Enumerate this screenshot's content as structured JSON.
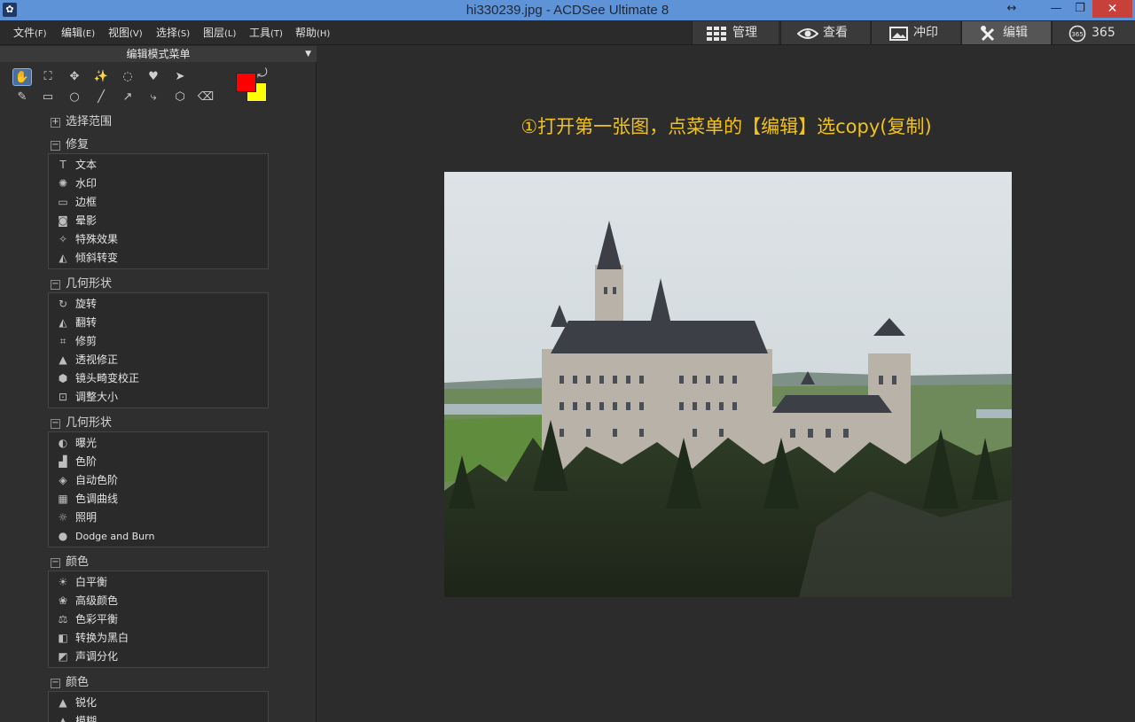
{
  "window": {
    "title": "hi330239.jpg - ACDSee Ultimate 8",
    "resize_glyph": "↔",
    "min_glyph": "—",
    "max_glyph": "❐",
    "close_glyph": "✕"
  },
  "menu": [
    {
      "label": "文件",
      "key": "(F)"
    },
    {
      "label": "编辑",
      "key": "(E)"
    },
    {
      "label": "视图",
      "key": "(V)"
    },
    {
      "label": "选择",
      "key": "(S)"
    },
    {
      "label": "图层",
      "key": "(L)"
    },
    {
      "label": "工具",
      "key": "(T)"
    },
    {
      "label": "帮助",
      "key": "(H)"
    }
  ],
  "mode_tabs": [
    {
      "label": "管理",
      "icon": "grid-icon"
    },
    {
      "label": "查看",
      "icon": "eye-icon"
    },
    {
      "label": "冲印",
      "icon": "photo-icon"
    },
    {
      "label": "编辑",
      "icon": "edit-tools-icon",
      "active": true
    },
    {
      "label": "365",
      "icon": "cloud-365-icon",
      "badge": "365"
    }
  ],
  "panel": {
    "title": "编辑模式菜单",
    "dropdown_glyph": "▼",
    "colors": {
      "foreground": "#ff0000",
      "background": "#ffff00"
    },
    "tools_row1": [
      "hand-icon",
      "transform-icon",
      "move-icon",
      "magic-wand-icon",
      "lasso-icon",
      "brush-select-icon",
      "auto-select-icon"
    ],
    "tools_row2": [
      "pen-icon",
      "rectangle-icon",
      "circle-icon",
      "line-icon",
      "arrow-icon",
      "curve-icon",
      "polygon-icon",
      "eraser-icon"
    ],
    "sections": [
      {
        "title": "选择范围",
        "expanded": false,
        "items": []
      },
      {
        "title": "修复",
        "expanded": true,
        "items": [
          {
            "label": "文本",
            "icon": "text-icon",
            "glyph": "T"
          },
          {
            "label": "水印",
            "icon": "watermark-icon",
            "glyph": "✺"
          },
          {
            "label": "边框",
            "icon": "border-icon",
            "glyph": "▭"
          },
          {
            "label": "晕影",
            "icon": "vignette-icon",
            "glyph": "◙"
          },
          {
            "label": "特殊效果",
            "icon": "special-effects-icon",
            "glyph": "✧"
          },
          {
            "label": "倾斜转变",
            "icon": "tilt-shift-icon",
            "glyph": "◭"
          }
        ]
      },
      {
        "title": "几何形状",
        "expanded": true,
        "items": [
          {
            "label": "旋转",
            "icon": "rotate-icon",
            "glyph": "↻"
          },
          {
            "label": "翻转",
            "icon": "flip-icon",
            "glyph": "◭"
          },
          {
            "label": "修剪",
            "icon": "crop-icon",
            "glyph": "⌗"
          },
          {
            "label": "透视修正",
            "icon": "perspective-icon",
            "glyph": "▲"
          },
          {
            "label": "镜头畸变校正",
            "icon": "lens-distortion-icon",
            "glyph": "⬢"
          },
          {
            "label": "调整大小",
            "icon": "resize-icon",
            "glyph": "⊡"
          }
        ]
      },
      {
        "title": "几何形状",
        "expanded": true,
        "items": [
          {
            "label": "曝光",
            "icon": "exposure-icon",
            "glyph": "◐"
          },
          {
            "label": "色阶",
            "icon": "levels-icon",
            "glyph": "▟"
          },
          {
            "label": "自动色阶",
            "icon": "auto-levels-icon",
            "glyph": "◈"
          },
          {
            "label": "色调曲线",
            "icon": "tone-curve-icon",
            "glyph": "▦"
          },
          {
            "label": "照明",
            "icon": "lighting-icon",
            "glyph": "☼"
          },
          {
            "label": "Dodge and Burn",
            "icon": "dodge-burn-icon",
            "glyph": "●"
          }
        ]
      },
      {
        "title": "颜色",
        "expanded": true,
        "items": [
          {
            "label": "白平衡",
            "icon": "white-balance-icon",
            "glyph": "☀"
          },
          {
            "label": "高级颜色",
            "icon": "advanced-color-icon",
            "glyph": "❀"
          },
          {
            "label": "色彩平衡",
            "icon": "color-balance-icon",
            "glyph": "⚖"
          },
          {
            "label": "转换为黑白",
            "icon": "black-white-icon",
            "glyph": "◧"
          },
          {
            "label": "声调分化",
            "icon": "split-tone-icon",
            "glyph": "◩"
          }
        ]
      },
      {
        "title": "颜色",
        "expanded": true,
        "items": [
          {
            "label": "锐化",
            "icon": "sharpen-icon",
            "glyph": "▲"
          },
          {
            "label": "模糊",
            "icon": "blur-icon",
            "glyph": "▲"
          }
        ]
      }
    ]
  },
  "main": {
    "caption": "①打开第一张图，点菜单的【编辑】选copy(复制)"
  }
}
